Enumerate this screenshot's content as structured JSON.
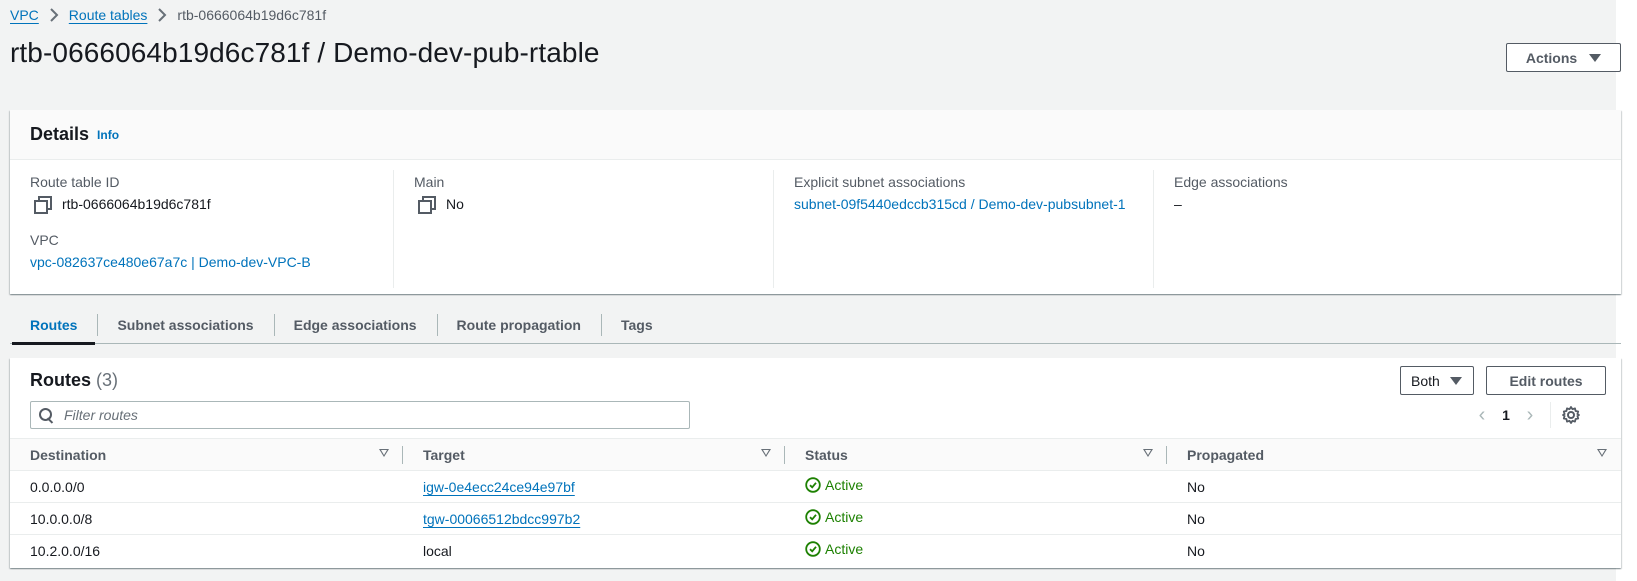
{
  "breadcrumb": {
    "items": [
      "VPC",
      "Route tables"
    ],
    "current": "rtb-0666064b19d6c781f"
  },
  "header": {
    "title": "rtb-0666064b19d6c781f / Demo-dev-pub-rtable",
    "actions_label": "Actions"
  },
  "details": {
    "title": "Details",
    "info_label": "Info",
    "route_table_id_label": "Route table ID",
    "route_table_id": "rtb-0666064b19d6c781f",
    "vpc_label": "VPC",
    "vpc_value": "vpc-082637ce480e67a7c | Demo-dev-VPC-B",
    "main_label": "Main",
    "main_value": "No",
    "explicit_subnet_label": "Explicit subnet associations",
    "explicit_subnet_value": "subnet-09f5440edccb315cd / Demo-dev-pubsubnet-1",
    "edge_label": "Edge associations",
    "edge_value": "–"
  },
  "tabs": [
    {
      "label": "Routes",
      "active": true
    },
    {
      "label": "Subnet associations",
      "active": false
    },
    {
      "label": "Edge associations",
      "active": false
    },
    {
      "label": "Route propagation",
      "active": false
    },
    {
      "label": "Tags",
      "active": false
    }
  ],
  "routes": {
    "title": "Routes",
    "count": "(3)",
    "filter_select": "Both",
    "edit_label": "Edit routes",
    "filter_placeholder": "Filter routes",
    "filter_value": "",
    "page": "1",
    "columns": [
      "Destination",
      "Target",
      "Status",
      "Propagated"
    ],
    "rows": [
      {
        "destination": "0.0.0.0/0",
        "target": "igw-0e4ecc24ce94e97bf",
        "target_link": true,
        "status": "Active",
        "propagated": "No"
      },
      {
        "destination": "10.0.0.0/8",
        "target": "tgw-00066512bdcc997b2",
        "target_link": true,
        "status": "Active",
        "propagated": "No"
      },
      {
        "destination": "10.2.0.0/16",
        "target": "local",
        "target_link": false,
        "status": "Active",
        "propagated": "No"
      }
    ]
  },
  "colors": {
    "link": "#0073bb",
    "success": "#1d8102",
    "text": "#16191f",
    "page_bg": "#f2f3f3"
  }
}
